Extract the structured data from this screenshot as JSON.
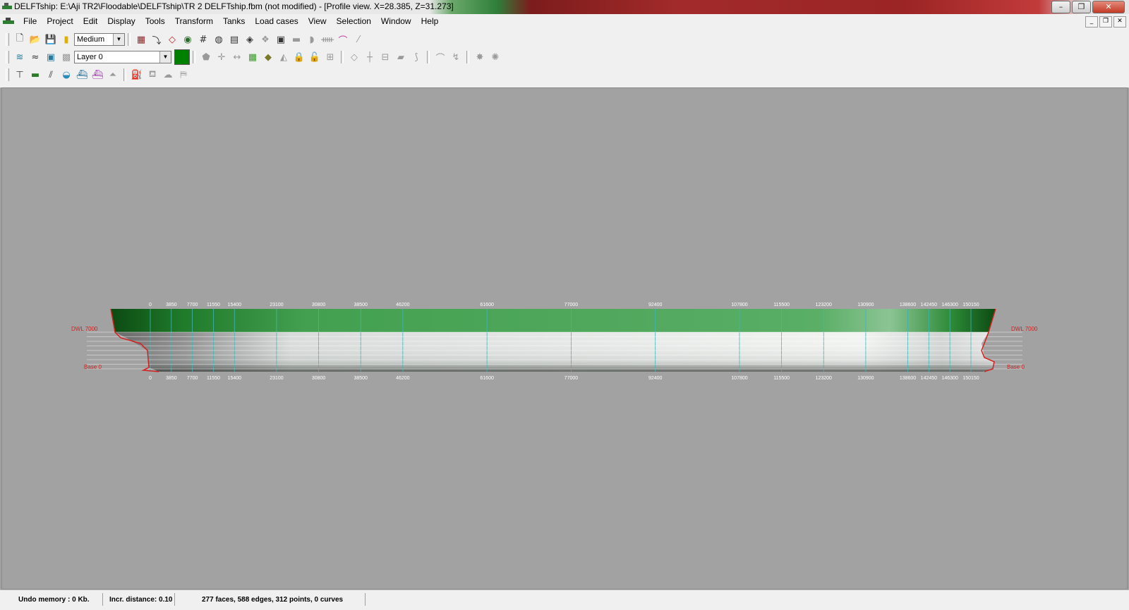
{
  "window": {
    "title": "DELFTship: E:\\Aji TR2\\Floodable\\DELFTship\\TR 2 DELFTship.fbm (not modified) - [Profile view.  X=28.385,   Z=31.273]",
    "minimize": "–",
    "restore": "❐",
    "close": "✕"
  },
  "menu": {
    "items": [
      "File",
      "Project",
      "Edit",
      "Display",
      "Tools",
      "Transform",
      "Tanks",
      "Load cases",
      "View",
      "Selection",
      "Window",
      "Help"
    ]
  },
  "toolbar": {
    "precision_value": "Medium",
    "layer_value": "Layer 0",
    "layer_color": "#008000"
  },
  "viewport": {
    "view": "Profile view",
    "station_labels": [
      "0",
      "3850",
      "7700",
      "11550",
      "15400",
      "23100",
      "30800",
      "38500",
      "46200",
      "61600",
      "77000",
      "92400",
      "107800",
      "115500",
      "123200",
      "130900",
      "138600",
      "142450",
      "146300",
      "150150"
    ],
    "station_x": [
      0,
      3850,
      7700,
      11550,
      15400,
      23100,
      30800,
      38500,
      46200,
      61600,
      77000,
      92400,
      107800,
      115500,
      123200,
      130900,
      138600,
      142450,
      146300,
      150150
    ],
    "dwl_label_left": "DWL 7000",
    "dwl_label_right": "DWL 7000",
    "base_label_left": "Base 0",
    "base_label_right": "Base 0",
    "colors": {
      "hull_top": "#3c9a47",
      "hull_dark": "#0c4a12",
      "hull_light": "#f2f4f2",
      "lines": "#3fb5b5",
      "control": "#d62020"
    }
  },
  "status": {
    "undo": "Undo memory : 0 Kb.",
    "incr": "Incr. distance: 0.10",
    "counts": "277 faces, 588 edges, 312 points, 0 curves"
  }
}
